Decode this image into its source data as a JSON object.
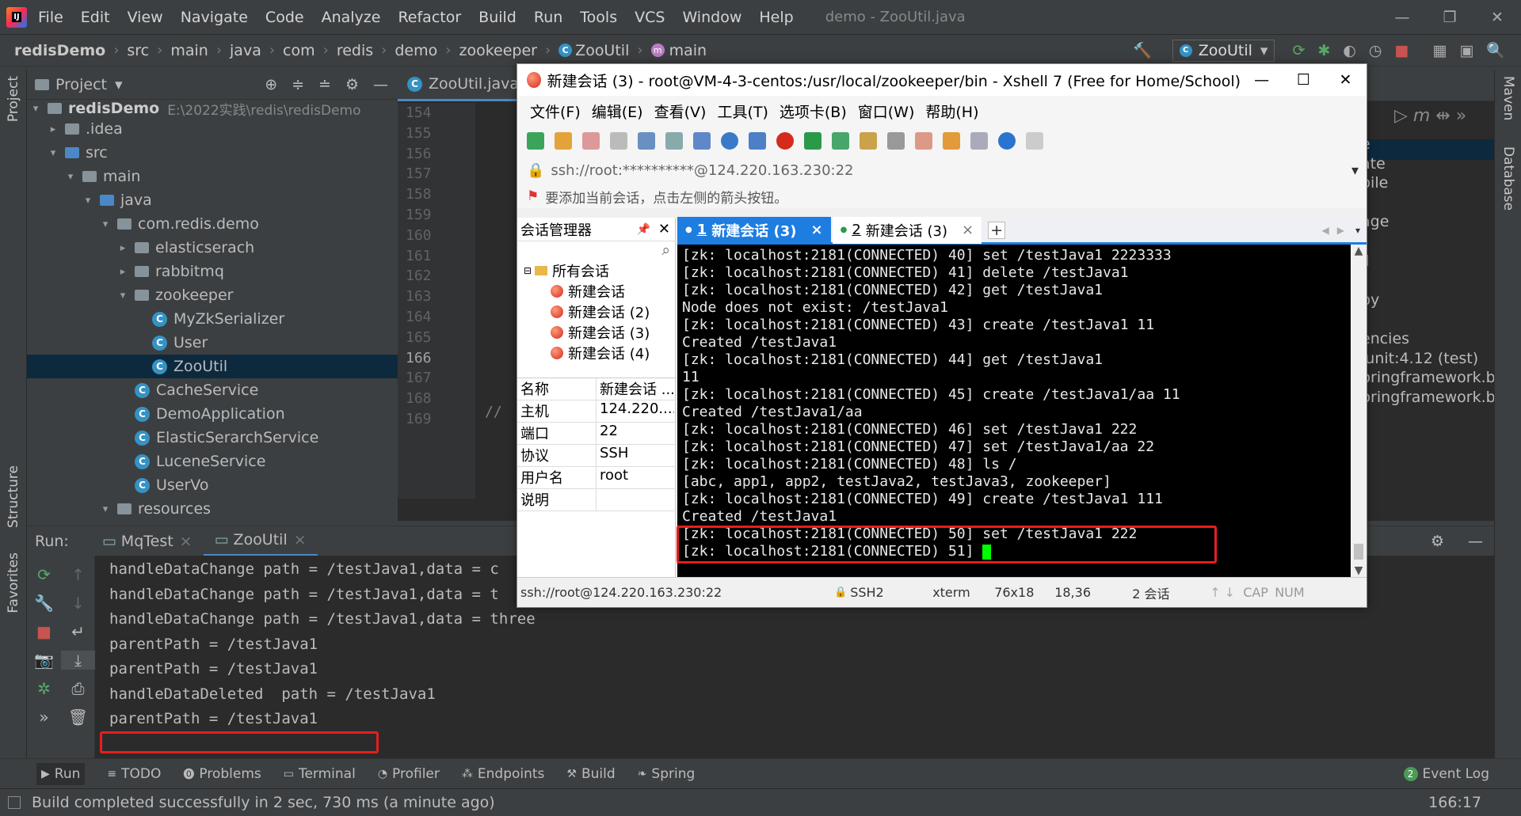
{
  "menubar": {
    "logo": "IJ",
    "items": [
      "File",
      "Edit",
      "View",
      "Navigate",
      "Code",
      "Analyze",
      "Refactor",
      "Build",
      "Run",
      "Tools",
      "VCS",
      "Window",
      "Help"
    ],
    "title": "demo - ZooUtil.java"
  },
  "navbar": {
    "crumbs": [
      "redisDemo",
      "src",
      "main",
      "java",
      "com",
      "redis",
      "demo",
      "zookeeper",
      "ZooUtil",
      "main"
    ],
    "run_config": "ZooUtil"
  },
  "project": {
    "header": "Project",
    "root": "redisDemo",
    "root_path": "E:\\2022实践\\redis\\redisDemo",
    "items": [
      {
        "label": ".idea",
        "indent": 1,
        "kind": "folder",
        "arrow": "▸"
      },
      {
        "label": "src",
        "indent": 1,
        "kind": "folder",
        "arrow": "▾"
      },
      {
        "label": "main",
        "indent": 2,
        "kind": "folder",
        "arrow": "▾"
      },
      {
        "label": "java",
        "indent": 3,
        "kind": "folder",
        "arrow": "▾"
      },
      {
        "label": "com.redis.demo",
        "indent": 4,
        "kind": "package",
        "arrow": "▾"
      },
      {
        "label": "elasticserach",
        "indent": 5,
        "kind": "package",
        "arrow": "▸"
      },
      {
        "label": "rabbitmq",
        "indent": 5,
        "kind": "package",
        "arrow": "▸"
      },
      {
        "label": "zookeeper",
        "indent": 5,
        "kind": "package",
        "arrow": "▾"
      },
      {
        "label": "MyZkSerializer",
        "indent": 6,
        "kind": "class",
        "arrow": ""
      },
      {
        "label": "User",
        "indent": 6,
        "kind": "class",
        "arrow": ""
      },
      {
        "label": "ZooUtil",
        "indent": 6,
        "kind": "class",
        "arrow": "",
        "selected": true
      },
      {
        "label": "CacheService",
        "indent": 5,
        "kind": "class",
        "arrow": ""
      },
      {
        "label": "DemoApplication",
        "indent": 5,
        "kind": "class",
        "arrow": ""
      },
      {
        "label": "ElasticSerarchService",
        "indent": 5,
        "kind": "class",
        "arrow": ""
      },
      {
        "label": "LuceneService",
        "indent": 5,
        "kind": "class",
        "arrow": ""
      },
      {
        "label": "UserVo",
        "indent": 5,
        "kind": "class",
        "arrow": ""
      },
      {
        "label": "resources",
        "indent": 4,
        "kind": "folder",
        "arrow": "▾"
      }
    ]
  },
  "editor": {
    "tab": "ZooUtil.java",
    "line_numbers": [
      "154",
      "155",
      "156",
      "157",
      "158",
      "159",
      "160",
      "161",
      "162",
      "163",
      "164",
      "165",
      "166",
      "167",
      "168",
      "169"
    ],
    "current_line": "166",
    "comment_text": "//",
    "right_fragments": [
      "e",
      "ate",
      "bile",
      "",
      "age",
      "/",
      "ll",
      "",
      "py",
      "",
      "encies",
      "junit:4.12 (test)",
      "pringframework.bo",
      "pringframework.bo"
    ]
  },
  "left_strip": {
    "project": "Project",
    "structure": "Structure",
    "favorites": "Favorites"
  },
  "right_strip": {
    "maven": "Maven",
    "database": "Database"
  },
  "run": {
    "label": "Run:",
    "tabs": [
      "MqTest",
      "ZooUtil"
    ],
    "active_tab": "ZooUtil",
    "lines": [
      "handleDataChange path = /testJava1,data = c",
      "handleDataChange path = /testJava1,data = t",
      "handleDataChange path = /testJava1,data = three",
      "parentPath = /testJava1",
      "parentPath = /testJava1",
      "handleDataDeleted  path = /testJava1",
      "parentPath = /testJava1",
      ""
    ]
  },
  "bottombar": {
    "items": [
      "Run",
      "TODO",
      "Problems",
      "Terminal",
      "Profiler",
      "Endpoints",
      "Build",
      "Spring"
    ],
    "event_log": "Event Log",
    "event_count": "2"
  },
  "status": {
    "message": "Build completed successfully in 2 sec, 730 ms (a minute ago)",
    "position": "166:17"
  },
  "xshell": {
    "title": "新建会话 (3) - root@VM-4-3-centos:/usr/local/zookeeper/bin - Xshell 7 (Free for Home/School)",
    "menu": [
      "文件(F)",
      "编辑(E)",
      "查看(V)",
      "工具(T)",
      "选项卡(B)",
      "窗口(W)",
      "帮助(H)"
    ],
    "address": "ssh://root:**********@124.220.163.230:22",
    "hint": "要添加当前会话，点击左侧的箭头按钮。",
    "session_panel": {
      "title": "会话管理器",
      "group": "所有会话",
      "sessions": [
        "新建会话",
        "新建会话 (2)",
        "新建会话 (3)",
        "新建会话 (4)"
      ],
      "props": [
        {
          "k": "名称",
          "v": "新建会话 ..."
        },
        {
          "k": "主机",
          "v": "124.220...."
        },
        {
          "k": "端口",
          "v": "22"
        },
        {
          "k": "协议",
          "v": "SSH"
        },
        {
          "k": "用户名",
          "v": "root"
        },
        {
          "k": "说明",
          "v": ""
        }
      ]
    },
    "tabs": [
      {
        "num": "1",
        "label": "新建会话 (3)",
        "active": true
      },
      {
        "num": "2",
        "label": "新建会话 (3)",
        "active": false
      }
    ],
    "terminal": [
      "[zk: localhost:2181(CONNECTED) 40] set /testJava1 2223333",
      "[zk: localhost:2181(CONNECTED) 41] delete /testJava1",
      "[zk: localhost:2181(CONNECTED) 42] get /testJava1",
      "Node does not exist: /testJava1",
      "[zk: localhost:2181(CONNECTED) 43] create /testJava1 11",
      "Created /testJava1",
      "[zk: localhost:2181(CONNECTED) 44] get /testJava1",
      "11",
      "[zk: localhost:2181(CONNECTED) 45] create /testJava1/aa 11",
      "Created /testJava1/aa",
      "[zk: localhost:2181(CONNECTED) 46] set /testJava1 222",
      "[zk: localhost:2181(CONNECTED) 47] set /testJava1/aa 22",
      "[zk: localhost:2181(CONNECTED) 48] ls /",
      "[abc, app1, app2, testJava2, testJava3, zookeeper]",
      "[zk: localhost:2181(CONNECTED) 49] create /testJava1 111",
      "Created /testJava1",
      "[zk: localhost:2181(CONNECTED) 50] set /testJava1 222",
      "[zk: localhost:2181(CONNECTED) 51] "
    ],
    "status": {
      "conn": "ssh://root@124.220.163.230:22",
      "proto": "SSH2",
      "term": "xterm",
      "size": "76x18",
      "cursor": "18,36",
      "sessions": "2 会话",
      "cap": "CAP",
      "num": "NUM"
    }
  },
  "colors": {
    "highlight_box": "#e81d1d",
    "cursor": "#00ff00",
    "selection": "#0d293e",
    "xshell_tab_accent": "#1e7de0"
  }
}
